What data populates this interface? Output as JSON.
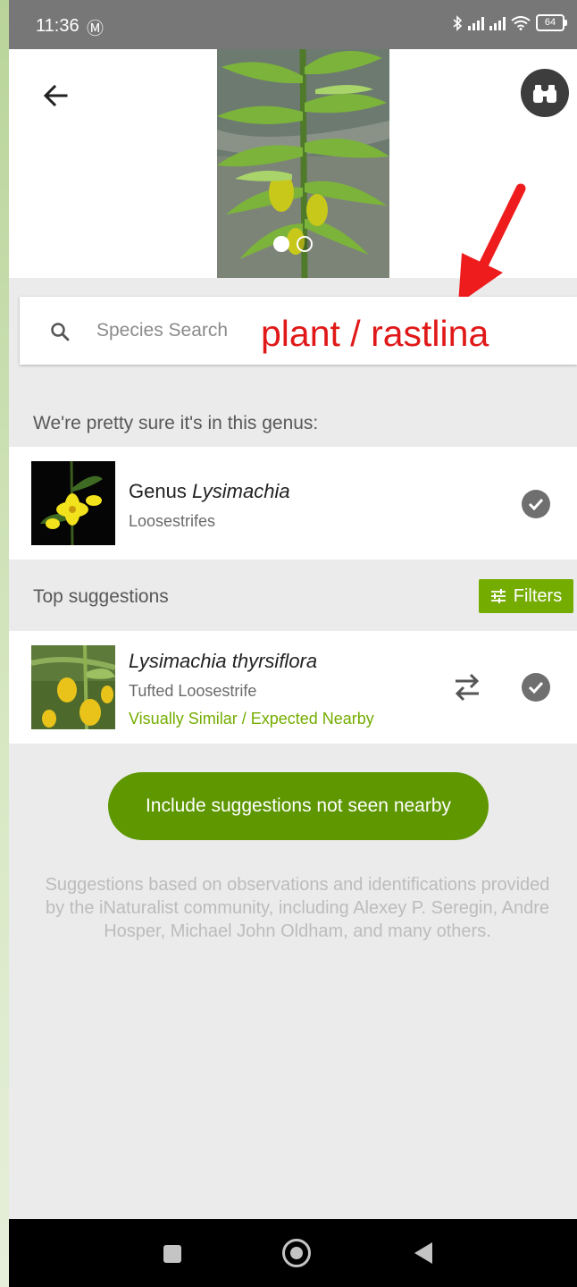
{
  "status_bar": {
    "time": "11:36",
    "mail_icon": "gmail-icon",
    "bluetooth_icon": "bluetooth-icon",
    "battery": "64"
  },
  "header": {
    "back_icon": "arrow-left-icon",
    "binoculars_icon": "binoculars-icon",
    "photo_count": 2,
    "active_photo": 1
  },
  "search": {
    "placeholder": "Species Search",
    "icon": "search-icon"
  },
  "annotation": {
    "text": "plant / rastlina",
    "color": "#e01818"
  },
  "genus_section": {
    "heading": "We're pretty sure it's in this genus:",
    "rank": "Genus",
    "name": "Lysimachia",
    "common_name": "Loosestrifes"
  },
  "top_suggestions": {
    "heading": "Top suggestions",
    "filters_label": "Filters",
    "items": [
      {
        "name": "Lysimachia thyrsiflora",
        "common_name": "Tufted Loosestrife",
        "tag": "Visually Similar / Expected Nearby"
      }
    ]
  },
  "include_button": "Include suggestions not seen nearby",
  "footer_note": "Suggestions based on observations and identifications provided by the iNaturalist community, including Alexey P. Seregin, Andre Hosper, Michael John Oldham, and many others.",
  "colors": {
    "accent_green": "#74ac00",
    "button_green": "#5e9700",
    "background": "#ebebeb"
  }
}
